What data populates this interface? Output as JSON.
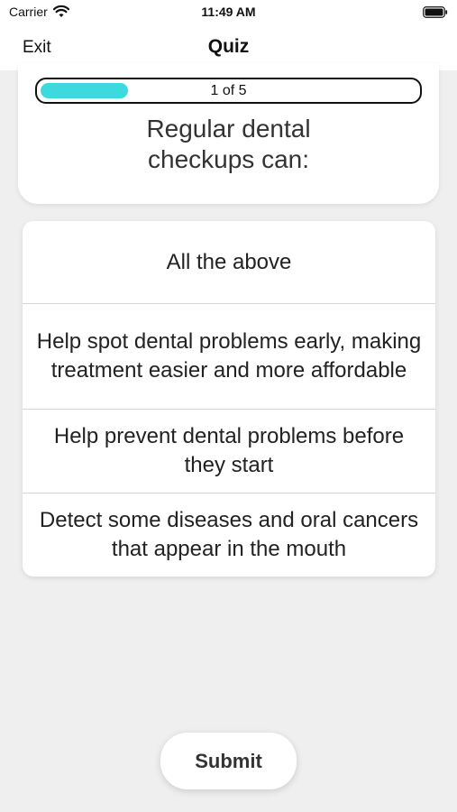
{
  "status_bar": {
    "carrier": "Carrier",
    "time": "11:49 AM"
  },
  "nav": {
    "exit_label": "Exit",
    "title": "Quiz"
  },
  "quiz": {
    "progress_label": "1 of 5",
    "progress_fraction": 0.2,
    "accent_color": "#3cd9df",
    "question": "Regular dental\ncheckups can:",
    "answers": [
      "All the above",
      "Help spot dental problems early, making treatment easier and more affordable",
      "Help  prevent dental problems before they start",
      "Detect some diseases and oral cancers that appear in the mouth"
    ],
    "submit_label": "Submit"
  }
}
